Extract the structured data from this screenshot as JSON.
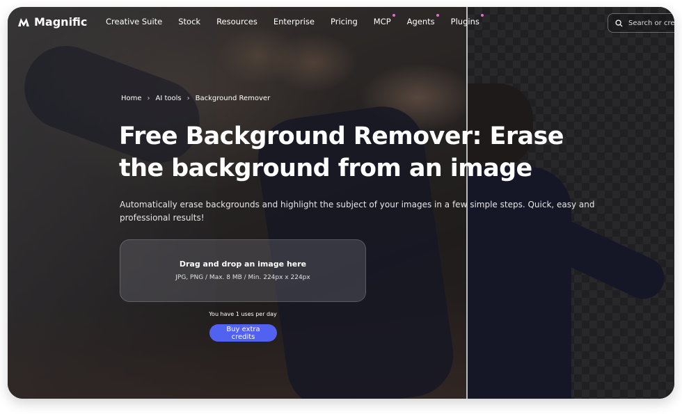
{
  "brand": {
    "name": "Magnific"
  },
  "nav": {
    "items": [
      {
        "label": "Creative Suite",
        "dot": false
      },
      {
        "label": "Stock",
        "dot": false
      },
      {
        "label": "Resources",
        "dot": false
      },
      {
        "label": "Enterprise",
        "dot": false
      },
      {
        "label": "Pricing",
        "dot": false
      },
      {
        "label": "MCP",
        "dot": true
      },
      {
        "label": "Agents",
        "dot": true
      },
      {
        "label": "Plugins",
        "dot": true
      }
    ],
    "search_placeholder": "Search or create"
  },
  "breadcrumb": {
    "items": [
      "Home",
      "AI tools",
      "Background Remover"
    ]
  },
  "hero": {
    "title": "Free Background Remover: Erase the background from an image",
    "subtitle": "Automatically erase backgrounds and highlight the subject of your images in a few simple steps. Quick, easy and professional results!"
  },
  "dropzone": {
    "title": "Drag and drop an image here",
    "hint": "JPG, PNG / Max. 8 MB / Min. 224px x 224px"
  },
  "usage": {
    "text": "You have 1 uses per day"
  },
  "cta": {
    "buy_label": "Buy extra credits"
  },
  "colors": {
    "accent": "#5262f0",
    "nav_dot": "#e46bd1"
  }
}
